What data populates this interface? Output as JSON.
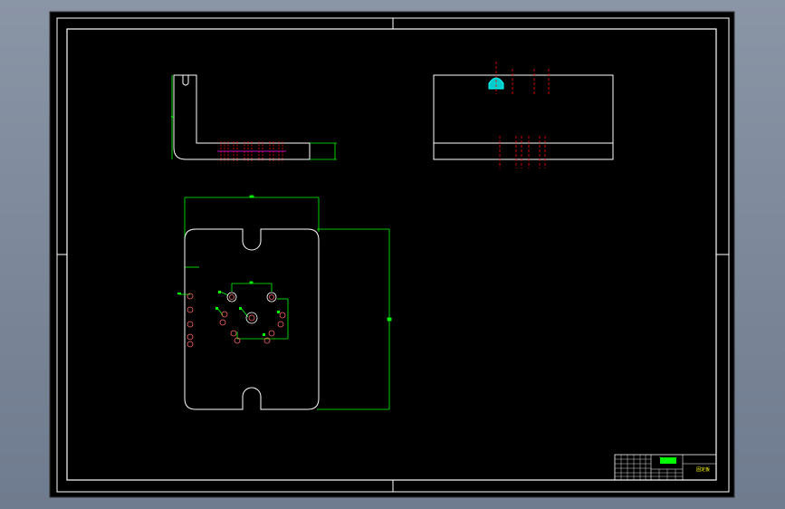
{
  "colors": {
    "background": "#7f8a9c",
    "paper": "#000000",
    "border": "#ffffff",
    "dimension": "#00ff00",
    "hidden_line": "#ff0000",
    "highlight": "#00ffff"
  },
  "title_block": {
    "drawing_name": "固定板",
    "part_code": "",
    "note": ""
  }
}
